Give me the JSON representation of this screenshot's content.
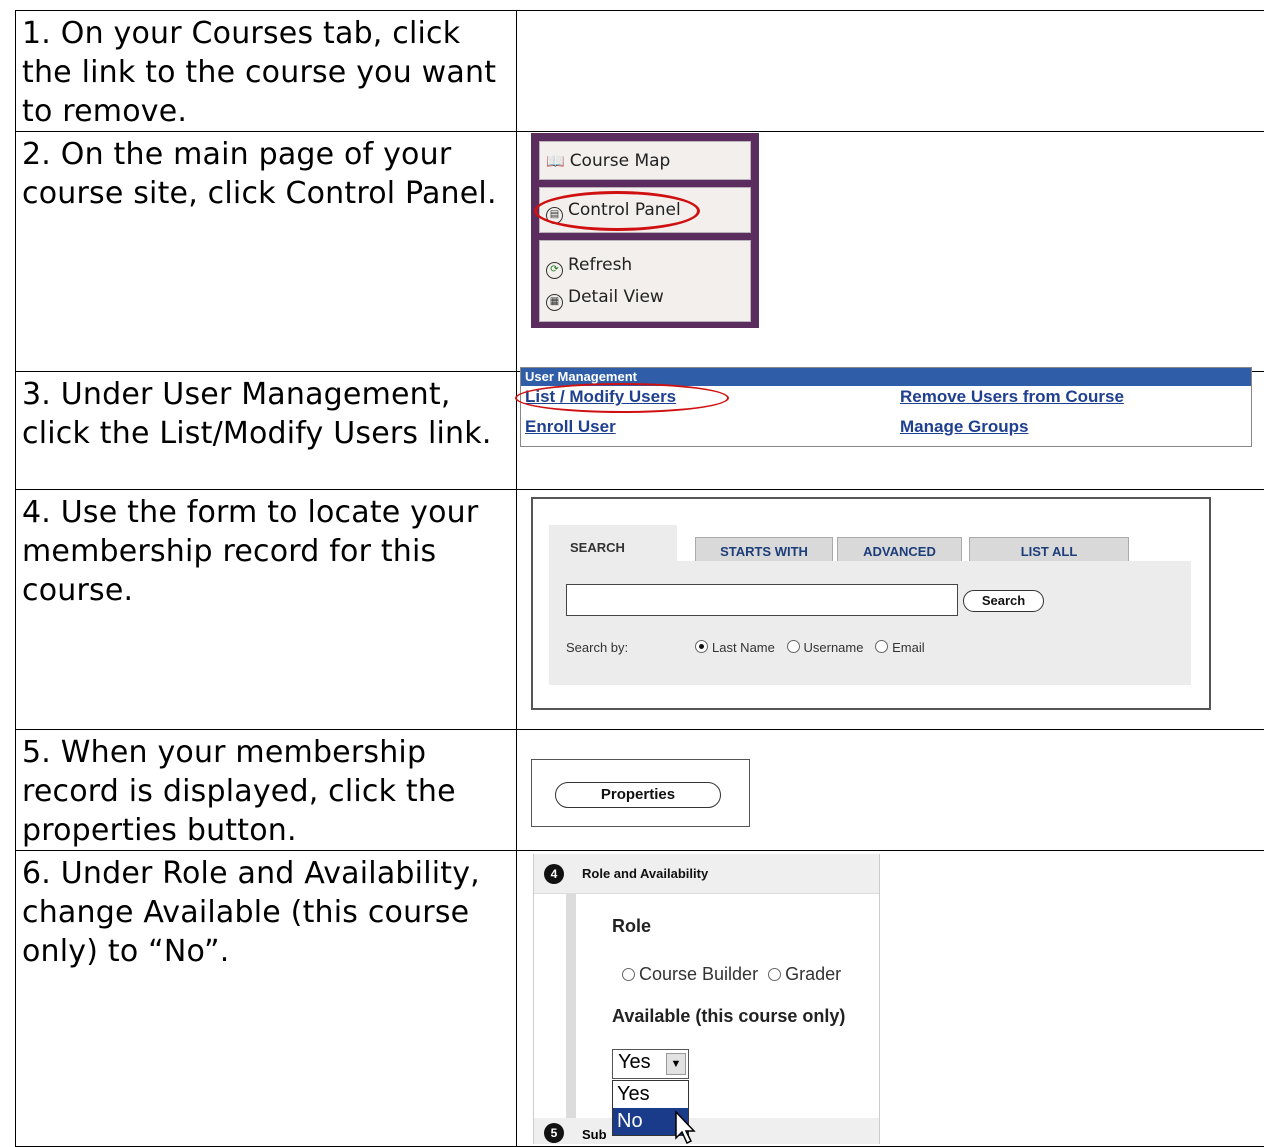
{
  "steps": [
    {
      "text": "1. On your Courses tab, click the link to the course you want to remove."
    },
    {
      "text": "2. On the main page of your course site, click Control Panel."
    },
    {
      "text": "3. Under User Management, click the List/Modify Users link."
    },
    {
      "text": "4. Use the form to locate your membership record for this course."
    },
    {
      "text": "5. When your membership record is displayed, click the properties button."
    },
    {
      "text": "6. Under Role and Availability, change Available (this course only) to “No”."
    }
  ],
  "course_menu": {
    "course_map": "Course Map",
    "control_panel": "Control Panel",
    "refresh": "Refresh",
    "detail_view": "Detail View"
  },
  "user_management": {
    "header": "User Management",
    "list_modify": "List / Modify Users",
    "enroll": "Enroll User",
    "remove": "Remove Users from Course",
    "groups": "Manage Groups"
  },
  "search_form": {
    "tabs": [
      "SEARCH",
      "STARTS WITH",
      "ADVANCED",
      "LIST ALL"
    ],
    "search_value": "",
    "search_button": "Search",
    "search_by": "Search by:",
    "options": [
      "Last Name",
      "Username",
      "Email"
    ],
    "selected": "Last Name"
  },
  "properties": {
    "button": "Properties"
  },
  "role_availability": {
    "section_number": "4",
    "section_title": "Role and Availability",
    "role_label": "Role",
    "role_options": [
      "Course Builder",
      "Grader"
    ],
    "available_label": "Available (this course only)",
    "selected_value": "Yes",
    "dropdown_options": [
      "Yes",
      "No"
    ],
    "highlighted": "No",
    "next_section_number": "5",
    "next_section_title": "Sub"
  },
  "colors": {
    "menu_frame": "#5b2c5e",
    "highlight_ellipse": "#d01010",
    "um_header": "#2f5da8",
    "link": "#1f3f8f",
    "dropdown_selected": "#1a3a8a"
  }
}
